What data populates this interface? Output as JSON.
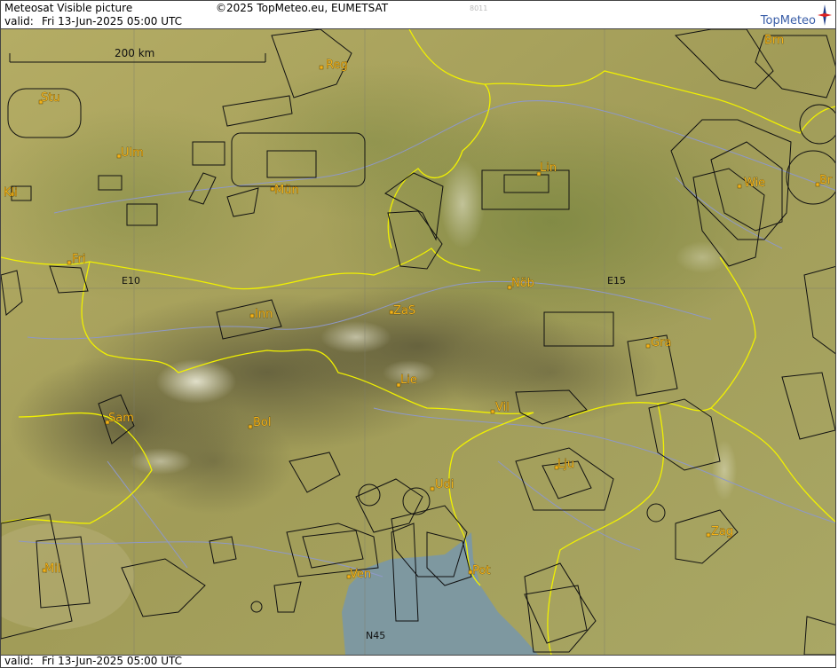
{
  "header": {
    "title": "Meteosat Visible picture",
    "copyright": "©2025 TopMeteo.eu, EUMETSAT",
    "valid_label": "valid:",
    "valid_time": "Fri  13-Jun-2025  05:00 UTC",
    "frame_id": "8011",
    "brand": "TopMeteo"
  },
  "footer": {
    "valid_label": "valid:",
    "valid_time": "Fri  13-Jun-2025  05:00 UTC"
  },
  "scale": {
    "label": "200 km"
  },
  "grid_labels": {
    "e10": "E10",
    "e15": "E15",
    "n45": "N45"
  },
  "cities": [
    {
      "id": "reg",
      "name": "Reg"
    },
    {
      "id": "brn",
      "name": "Brn"
    },
    {
      "id": "stu",
      "name": "Stu"
    },
    {
      "id": "ulm",
      "name": "Ulm"
    },
    {
      "id": "lin",
      "name": "Lin"
    },
    {
      "id": "kli",
      "name": "Kli"
    },
    {
      "id": "mun",
      "name": "Mün"
    },
    {
      "id": "wie",
      "name": "Wie"
    },
    {
      "id": "br",
      "name": "Br"
    },
    {
      "id": "fri",
      "name": "Fri"
    },
    {
      "id": "nob",
      "name": "Nöb"
    },
    {
      "id": "zas",
      "name": "ZaS"
    },
    {
      "id": "inn",
      "name": "Inn"
    },
    {
      "id": "gra",
      "name": "Gra"
    },
    {
      "id": "lie",
      "name": "Lie"
    },
    {
      "id": "vil",
      "name": "Vil"
    },
    {
      "id": "sam",
      "name": "Sam"
    },
    {
      "id": "bol",
      "name": "Bol"
    },
    {
      "id": "lju",
      "name": "Lju"
    },
    {
      "id": "udi",
      "name": "Udi"
    },
    {
      "id": "zag",
      "name": "Zag"
    },
    {
      "id": "mil",
      "name": "Mil"
    },
    {
      "id": "ven",
      "name": "Ven"
    },
    {
      "id": "pot",
      "name": "Pot"
    }
  ],
  "colors": {
    "terrain": "#a7a25a",
    "forest": "#7f8a3f",
    "border": "#f0f000",
    "airspace": "#111111",
    "river": "#8e98c8",
    "sea": "#7e98a0",
    "city": "#f2b21a"
  },
  "icons": {
    "logo": "compass-star-icon"
  }
}
